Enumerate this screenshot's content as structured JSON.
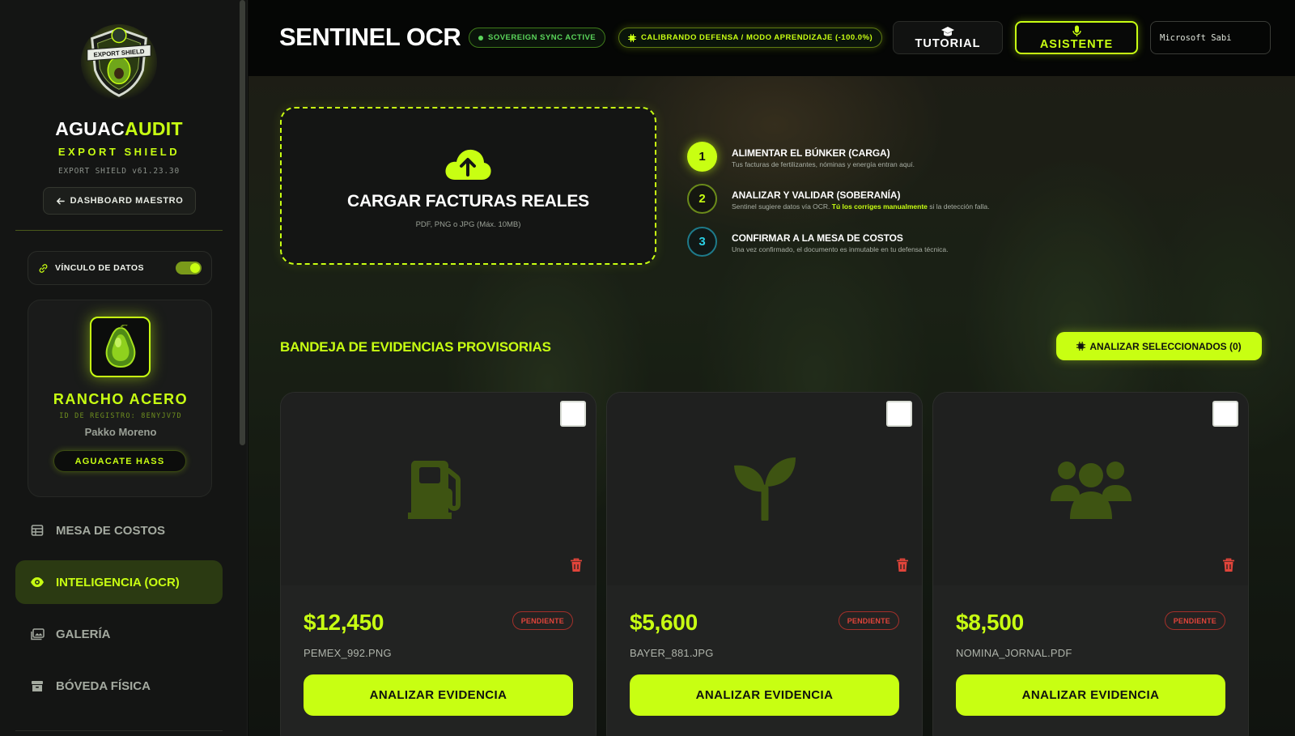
{
  "sidebar": {
    "brand": {
      "title_a": "AGUAC",
      "title_b": "AUDIT",
      "subtitle": "EXPORT SHIELD",
      "version": "EXPORT SHIELD v61.23.30",
      "logo_text": "EXPORT SHIELD",
      "logo_icon": "shield-avocado-logo"
    },
    "dashboard_button": "DASHBOARD MAESTRO",
    "data_link": {
      "label": "VÍNCULO DE DATOS",
      "enabled": true
    },
    "ranch": {
      "name": "RANCHO ACERO",
      "id_label": "ID DE REGISTRO: 8ENYJV7D",
      "owner": "Pakko Moreno",
      "variety": "AGUACATE HASS"
    },
    "nav": [
      {
        "label": "MESA DE COSTOS",
        "icon": "table-icon",
        "active": false
      },
      {
        "label": "INTELIGENCIA (OCR)",
        "icon": "eye-icon",
        "active": true
      },
      {
        "label": "GALERÍA",
        "icon": "gallery-icon",
        "active": false
      },
      {
        "label": "BÓVEDA FÍSICA",
        "icon": "archive-icon",
        "active": false
      }
    ]
  },
  "header": {
    "title": "SENTINEL OCR",
    "sync_badge": "SOVEREIGN SYNC ACTIVE",
    "calib_badge": "CALIBRANDO DEFENSA / MODO APRENDIZAJE (-100.0%)",
    "tutorial_button": "TUTORIAL",
    "assistant_button": "ASISTENTE",
    "voice_select": "Microsoft Sabi"
  },
  "upload": {
    "title": "CARGAR FACTURAS REALES",
    "subtitle": "PDF, PNG o JPG (Máx. 10MB)"
  },
  "steps": [
    {
      "num": "1",
      "title": "ALIMENTAR EL BÚNKER (CARGA)",
      "desc": "Tus facturas de fertilizantes, nóminas y energía entran aquí."
    },
    {
      "num": "2",
      "title": "ANALIZAR Y VALIDAR (SOBERANÍA)",
      "desc_a": "Sentinel sugiere datos vía OCR. ",
      "desc_hl": "Tú los corriges manualmente",
      "desc_b": " si la detección falla."
    },
    {
      "num": "3",
      "title": "CONFIRMAR A LA MESA DE COSTOS",
      "desc": "Una vez confirmado, el documento es inmutable en tu defensa técnica."
    }
  ],
  "tray": {
    "title": "BANDEJA DE EVIDENCIAS PROVISORIAS",
    "analyze_selected": "ANALIZAR SELECCIONADOS (0)"
  },
  "cards": [
    {
      "amount": "$12,450",
      "status": "PENDIENTE",
      "file": "PEMEX_992.PNG",
      "icon": "fuel-pump-icon",
      "button": "ANALIZAR EVIDENCIA"
    },
    {
      "amount": "$5,600",
      "status": "PENDIENTE",
      "file": "BAYER_881.JPG",
      "icon": "seedling-icon",
      "button": "ANALIZAR EVIDENCIA"
    },
    {
      "amount": "$8,500",
      "status": "PENDIENTE",
      "file": "NOMINA_JORNAL.PDF",
      "icon": "users-icon",
      "button": "ANALIZAR EVIDENCIA"
    }
  ],
  "colors": {
    "accent": "#c8ff12",
    "danger": "#e0443a",
    "sync": "#5bd65b",
    "step3": "#2ad1e6"
  }
}
